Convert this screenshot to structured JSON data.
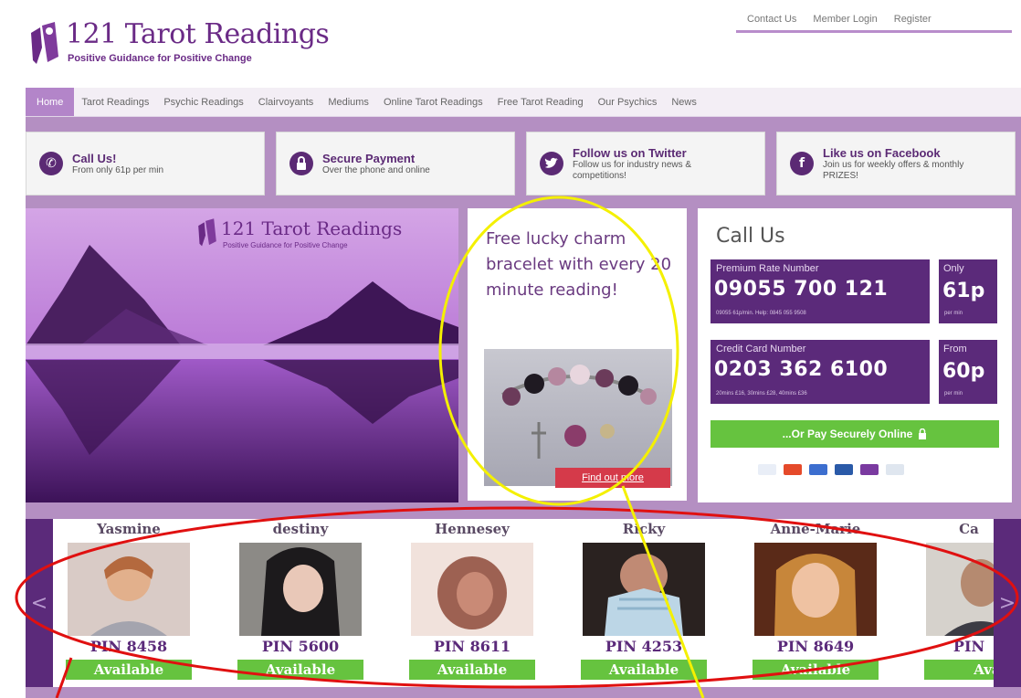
{
  "header": {
    "logo_title": "121 Tarot Readings",
    "logo_tagline": "Positive Guidance for Positive Change",
    "top_links": [
      "Contact Us",
      "Member Login",
      "Register"
    ]
  },
  "nav": {
    "items": [
      "Home",
      "Tarot Readings",
      "Psychic Readings",
      "Clairvoyants",
      "Mediums",
      "Online Tarot Readings",
      "Free Tarot Reading",
      "Our Psychics",
      "News"
    ],
    "active": "Home"
  },
  "features": [
    {
      "icon": "phone-icon",
      "title": "Call Us!",
      "desc": "From only 61p per min"
    },
    {
      "icon": "lock-icon",
      "title": "Secure Payment",
      "desc": "Over the phone and online"
    },
    {
      "icon": "twitter-icon",
      "title": "Follow us on Twitter",
      "desc": "Follow us for industry news & competitions!"
    },
    {
      "icon": "facebook-icon",
      "title": "Like us on Facebook",
      "desc": "Join us for weekly offers & monthly PRIZES!"
    }
  ],
  "hero": {
    "logo_title": "121 Tarot Readings",
    "logo_tagline": "Positive Guidance for Positive Change"
  },
  "promo": {
    "text": "Free lucky charm bracelet with every 20 minute reading!",
    "button": "Find out more"
  },
  "callus": {
    "title": "Call Us",
    "premium": {
      "label": "Premium Rate Number",
      "number": "09055 700 121",
      "small": "09055 61p/min. Help: 0845 055 9508",
      "price_label": "Only",
      "price": "61p",
      "price_unit": "per min"
    },
    "credit": {
      "label": "Credit Card Number",
      "number": "0203 362 6100",
      "small": "20mins £16, 30mins £28, 40mins £36",
      "price_label": "From",
      "price": "60p",
      "price_unit": "per min"
    },
    "pay_button": "...Or Pay Securely Online",
    "cards": [
      "visa",
      "mastercard",
      "amex",
      "maestro",
      "solo",
      "paypal"
    ]
  },
  "psychics": [
    {
      "name": "Yasmine",
      "pin": "PIN 8458",
      "status": "Available"
    },
    {
      "name": "destiny",
      "pin": "PIN 5600",
      "status": "Available"
    },
    {
      "name": "Hennesey",
      "pin": "PIN 8611",
      "status": "Available"
    },
    {
      "name": "Ricky",
      "pin": "PIN 4253",
      "status": "Available"
    },
    {
      "name": "Anne-Marie",
      "pin": "PIN 8649",
      "status": "Available"
    },
    {
      "name": "Ca",
      "pin": "PIN",
      "status": "Ava"
    }
  ],
  "carousel": {
    "prev": "<",
    "next": ">"
  },
  "colors": {
    "brand_purple": "#5b2a7a",
    "panel_purple": "#b48fc2",
    "available_green": "#66c33f",
    "promo_red": "#d53a4a",
    "annotation_yellow": "#f4f000",
    "annotation_red": "#e01010"
  }
}
